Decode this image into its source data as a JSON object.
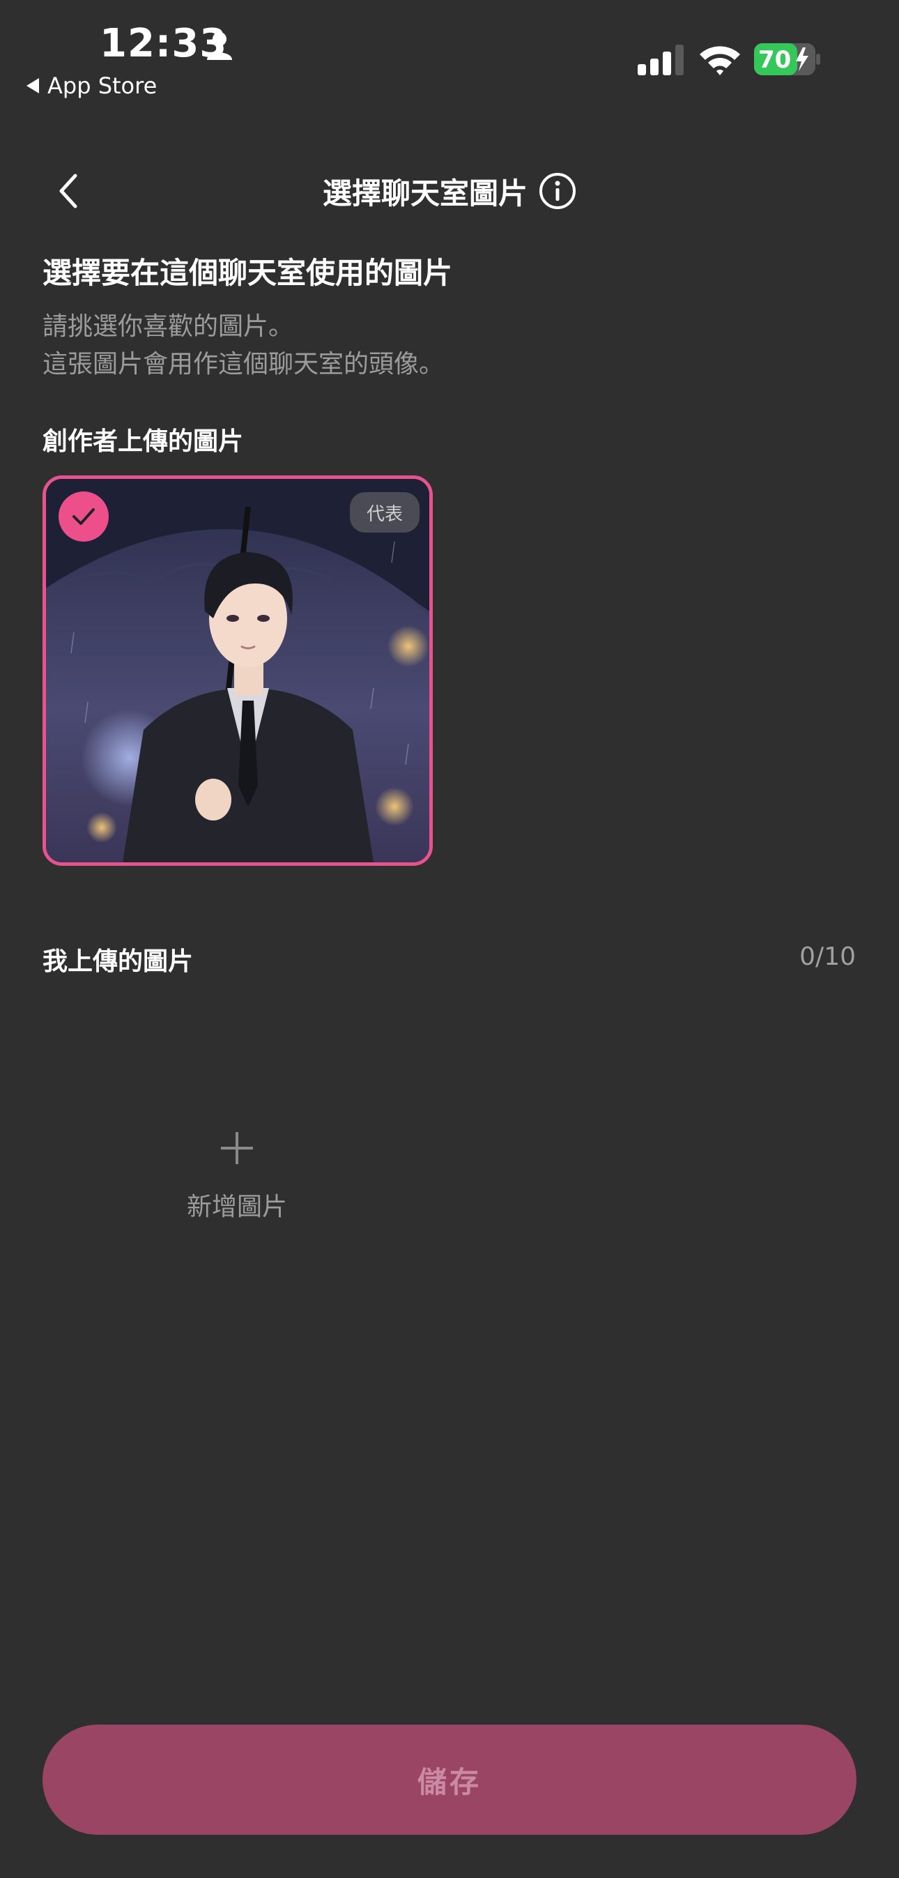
{
  "status_bar": {
    "time": "12:33",
    "back_app": "App Store",
    "battery": "70",
    "person_icon": "person-icon",
    "signal_icon": "cellular-signal-icon",
    "wifi_icon": "wifi-icon",
    "battery_icon": "battery-charging-icon"
  },
  "nav": {
    "back_icon": "chevron-left-icon",
    "title": "選擇聊天室圖片",
    "info_icon": "info-circle-icon"
  },
  "intro": {
    "heading": "選擇要在這個聊天室使用的圖片",
    "desc_line1": "請挑選你喜歡的圖片。",
    "desc_line2": "這張圖片會用作這個聊天室的頭像。"
  },
  "creator_section": {
    "label": "創作者上傳的圖片",
    "images": [
      {
        "selected": true,
        "badge": "代表",
        "check_icon": "checkmark-icon"
      }
    ]
  },
  "my_section": {
    "label": "我上傳的圖片",
    "count": "0/10",
    "add_label": "新增圖片",
    "add_icon": "plus-icon"
  },
  "footer": {
    "save_label": "儲存"
  },
  "colors": {
    "background": "#2f2f2f",
    "accent": "#ec4f8a",
    "save_button": "#9b4564",
    "secondary_text": "#9c9c9c",
    "battery_green": "#34c759"
  }
}
